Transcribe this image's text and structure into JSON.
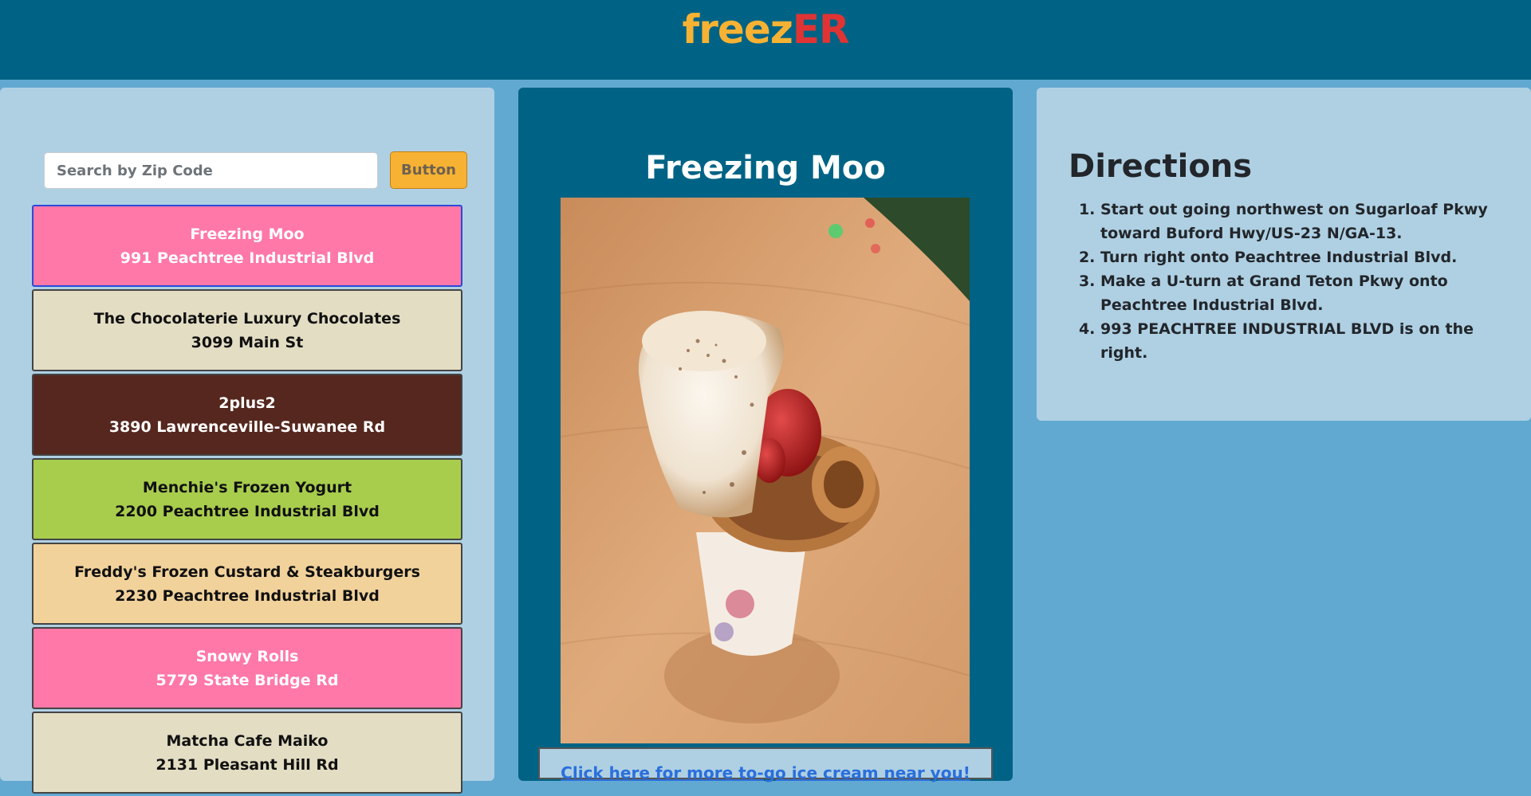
{
  "header": {
    "logo_part1": "freez",
    "logo_part2": "ER",
    "logo_color1": "#f7b233",
    "logo_color2": "#e03434"
  },
  "search": {
    "placeholder": "Search by Zip Code",
    "value": "",
    "button_label": "Button"
  },
  "stores": [
    {
      "name": "Freezing Moo",
      "address": "991 Peachtree Industrial Blvd",
      "bg": "#ff78a8",
      "fg": "#ffffff"
    },
    {
      "name": "The Chocolaterie Luxury Chocolates",
      "address": "3099 Main St",
      "bg": "#e3ddc3",
      "fg": "#111111"
    },
    {
      "name": "2plus2",
      "address": "3890 Lawrenceville-Suwanee Rd",
      "bg": "#55271e",
      "fg": "#ffffff"
    },
    {
      "name": "Menchie's Frozen Yogurt",
      "address": "2200 Peachtree Industrial Blvd",
      "bg": "#a8cd4d",
      "fg": "#111111"
    },
    {
      "name": "Freddy's Frozen Custard & Steakburgers",
      "address": "2230 Peachtree Industrial Blvd",
      "bg": "#f2d29b",
      "fg": "#111111"
    },
    {
      "name": "Snowy Rolls",
      "address": "5779 State Bridge Rd",
      "bg": "#ff78a8",
      "fg": "#ffffff"
    },
    {
      "name": "Matcha Cafe Maiko",
      "address": "2131 Pleasant Hill Rd",
      "bg": "#e3ddc3",
      "fg": "#111111"
    }
  ],
  "detail": {
    "title": "Freezing Moo",
    "bottom_link": "Click here for more to-go ice cream near you!"
  },
  "directions": {
    "title": "Directions",
    "steps": [
      "Start out going northwest on Sugarloaf Pkwy toward Buford Hwy/US-23 N/GA-13.",
      "Turn right onto Peachtree Industrial Blvd.",
      "Make a U-turn at Grand Teton Pkwy onto Peachtree Industrial Blvd.",
      "993 PEACHTREE INDUSTRIAL BLVD is on the right."
    ]
  }
}
